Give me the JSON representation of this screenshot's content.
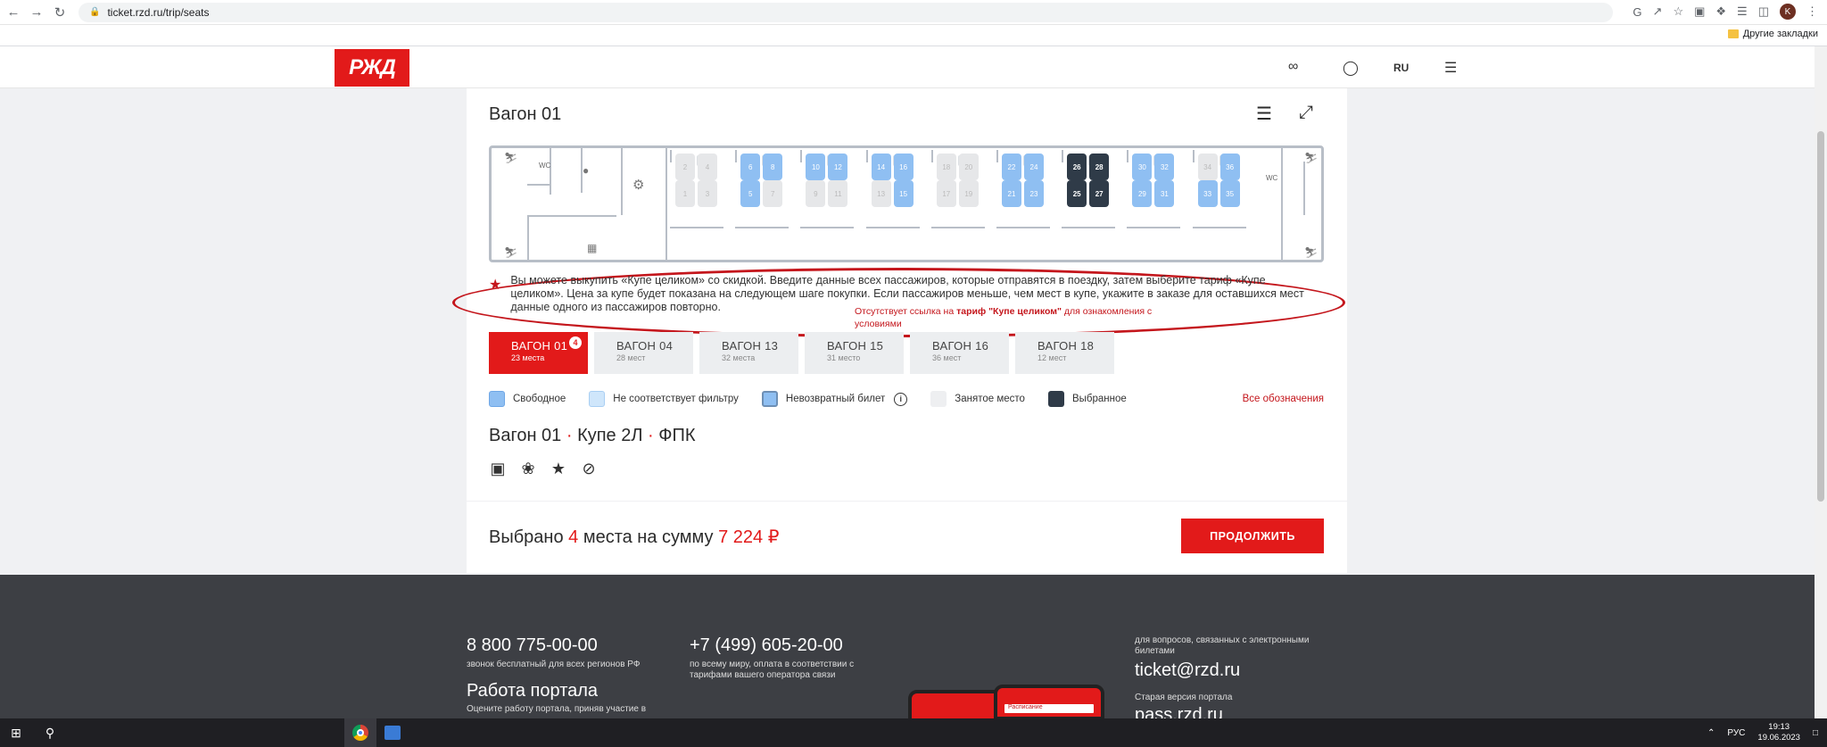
{
  "browser": {
    "url": "ticket.rzd.ru/trip/seats",
    "bookmark": "Другие закладки",
    "avatar_letter": "K"
  },
  "header": {
    "logo": "РЖД",
    "lang": "RU"
  },
  "car": {
    "title": "Вагон 01",
    "wc_label": "WC",
    "seats_upper": [
      "2",
      "4",
      "6",
      "8",
      "10",
      "12",
      "14",
      "16",
      "18",
      "20",
      "22",
      "24",
      "26",
      "28",
      "30",
      "32",
      "34",
      "36"
    ],
    "seats_lower": [
      "1",
      "3",
      "5",
      "7",
      "9",
      "11",
      "13",
      "15",
      "17",
      "19",
      "21",
      "23",
      "25",
      "27",
      "29",
      "31",
      "33",
      "35"
    ]
  },
  "info": {
    "text": "Вы можете выкупить «Купе целиком» со скидкой. Введите данные всех пассажиров, которые отправятся в поездку, затем выберите тариф «Купе целиком». Цена за купе будет показана на следующем шаге покупки. Если пассажиров меньше, чем мест в купе, укажите в заказе для оставшихся мест данные одного из пассажиров повторно."
  },
  "annotation": {
    "part1": "Отсутствует ссылка на ",
    "bold": "тариф \"Купе целиком\"",
    "part2": " для ознакомления с условиями"
  },
  "tabs": [
    {
      "name": "ВАГОН 01",
      "sub": "23 места",
      "badge": "4"
    },
    {
      "name": "ВАГОН 04",
      "sub": "28 мест"
    },
    {
      "name": "ВАГОН 13",
      "sub": "32 места"
    },
    {
      "name": "ВАГОН 15",
      "sub": "31 место"
    },
    {
      "name": "ВАГОН 16",
      "sub": "36 мест"
    },
    {
      "name": "ВАГОН 18",
      "sub": "12 мест"
    }
  ],
  "legend": {
    "free": "Свободное",
    "nofilter": "Не соответствует фильтру",
    "nonrefund": "Невозвратный билет",
    "occupied": "Занятое место",
    "selected": "Выбранное",
    "all": "Все обозначения"
  },
  "car_info": {
    "car": "Вагон 01",
    "sep": " · ",
    "klass": "Купе 2Л",
    "carrier": "ФПК"
  },
  "summary": {
    "prefix": "Выбрано ",
    "count": "4",
    "middle": " места на сумму ",
    "amount": "7 224 ₽",
    "button": "ПРОДОЛЖИТЬ"
  },
  "footer": {
    "phone1": "8 800 775-00-00",
    "phone1_note": "звонок бесплатный для всех регионов РФ",
    "phone2": "+7 (499) 605-20-00",
    "phone2_note": "по всему миру, оплата в соответствии с тарифами вашего оператора связи",
    "portal_title": "Работа портала",
    "portal_note": "Оцените работу портала, приняв участие в",
    "email_note": "для вопросов, связанных с электронными билетами",
    "email": "ticket@rzd.ru",
    "old_note": "Старая версия портала",
    "old_site": "pass.rzd.ru",
    "app_bar": "Расписание"
  },
  "taskbar": {
    "lang": "РУС",
    "time": "19:13",
    "date": "19.06.2023"
  }
}
